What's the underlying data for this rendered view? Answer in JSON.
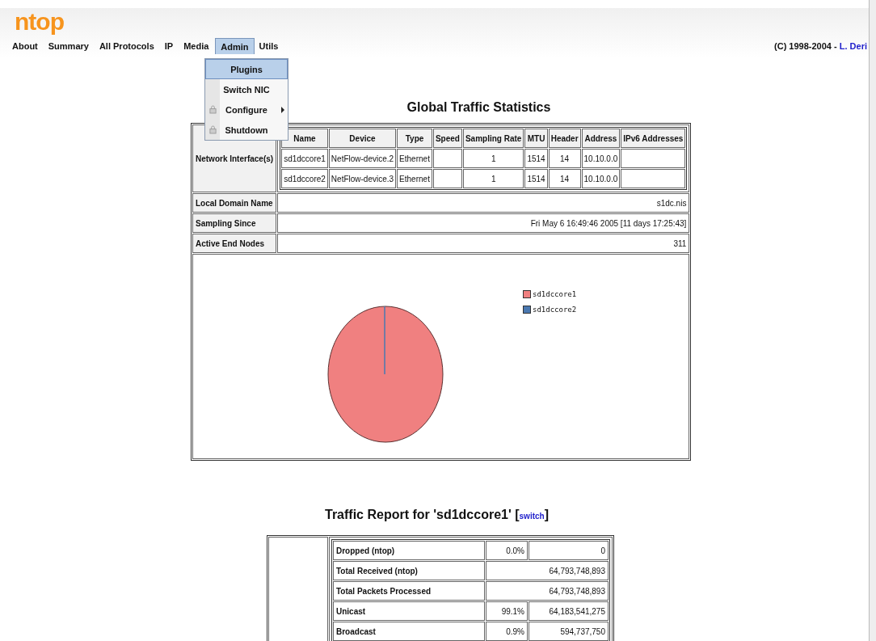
{
  "logo": "ntop",
  "menu": [
    {
      "label": "About",
      "selected": false
    },
    {
      "label": "Summary",
      "selected": false
    },
    {
      "label": "All Protocols",
      "selected": false
    },
    {
      "label": "IP",
      "selected": false
    },
    {
      "label": "Media",
      "selected": false
    },
    {
      "label": "Admin",
      "selected": true
    },
    {
      "label": "Utils",
      "selected": false
    }
  ],
  "copyright": {
    "text": "(C) 1998-2004 - ",
    "link": "L. Deri"
  },
  "dropdown": [
    {
      "label": "Plugins",
      "selected": true,
      "locked": false,
      "submenu": false
    },
    {
      "label": "Switch NIC",
      "selected": false,
      "locked": false,
      "submenu": false
    },
    {
      "label": "Configure",
      "selected": false,
      "locked": true,
      "submenu": true
    },
    {
      "label": "Shutdown",
      "selected": false,
      "locked": true,
      "submenu": false
    }
  ],
  "global": {
    "title": "Global Traffic Statistics",
    "interfaces_label": "Network Interface(s)",
    "columns": [
      "Name",
      "Device",
      "Type",
      "Speed",
      "Sampling Rate",
      "MTU",
      "Header",
      "Address",
      "IPv6 Addresses"
    ],
    "interfaces": [
      {
        "name": "sd1dccore1",
        "device": "NetFlow-device.2",
        "type": "Ethernet",
        "sampling_rate": "1",
        "mtu": "1514",
        "header": "14",
        "address": "10.10.0.0"
      },
      {
        "name": "sd1dccore2",
        "device": "NetFlow-device.3",
        "type": "Ethernet",
        "sampling_rate": "1",
        "mtu": "1514",
        "header": "14",
        "address": "10.10.0.0"
      }
    ],
    "rows": [
      {
        "label": "Local Domain Name",
        "value": "s1dc.nis"
      },
      {
        "label": "Sampling Since",
        "value": "Fri May 6 16:49:46 2005 [11 days 17:25:43]"
      },
      {
        "label": "Active End Nodes",
        "value": "311"
      }
    ],
    "legend": [
      {
        "label": "sd1dccore1",
        "color": "#f08080"
      },
      {
        "label": "sd1dccore2",
        "color": "#4a78b0"
      }
    ]
  },
  "report": {
    "title": "Traffic Report for 'sd1dccore1' [",
    "link": "switch",
    "title_end": "]",
    "rows": [
      {
        "label": "Dropped (ntop)",
        "percent": "0.0%",
        "value": "0"
      },
      {
        "label": "Total Received (ntop)",
        "value": "64,793,748,893"
      },
      {
        "label": "Total Packets Processed",
        "value": "64,793,748,893"
      },
      {
        "label": "Unicast",
        "percent": "99.1%",
        "value": "64,183,541,275"
      },
      {
        "label": "Broadcast",
        "percent": "0.9%",
        "value": "594,737,750"
      }
    ]
  }
}
